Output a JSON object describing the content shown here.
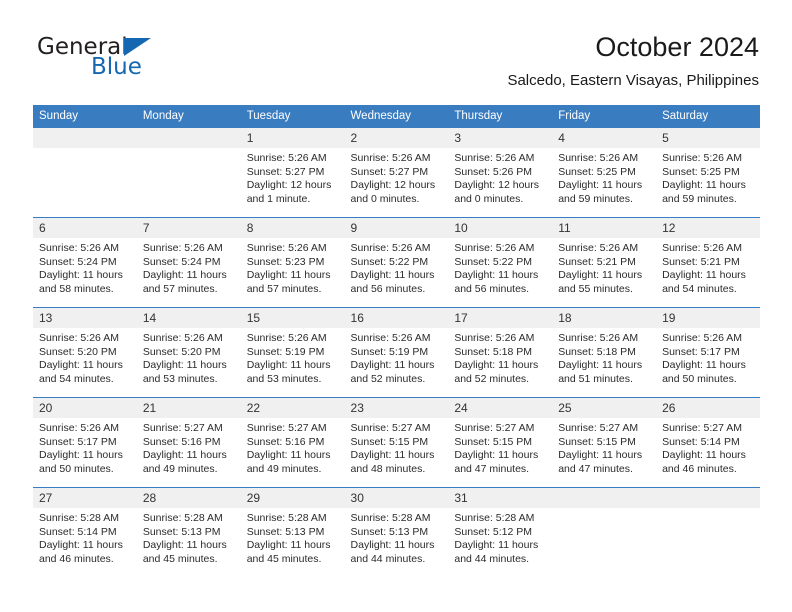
{
  "logo": {
    "word_top": "General",
    "word_bottom": "Blue",
    "triangle_color": "#1567b2",
    "text_color": "#231f20"
  },
  "header": {
    "title": "October 2024",
    "subtitle": "Salcedo, Eastern Visayas, Philippines"
  },
  "theme": {
    "header_blue": "#3a7cc0",
    "daynum_bg": "#f0f0f0",
    "text": "#2b2b2b"
  },
  "weekdays": [
    "Sunday",
    "Monday",
    "Tuesday",
    "Wednesday",
    "Thursday",
    "Friday",
    "Saturday"
  ],
  "labels": {
    "sunrise": "Sunrise:",
    "sunset": "Sunset:",
    "daylight": "Daylight:"
  },
  "weeks": [
    [
      {
        "day": "",
        "sunrise": "",
        "sunset": "",
        "daylight": ""
      },
      {
        "day": "",
        "sunrise": "",
        "sunset": "",
        "daylight": ""
      },
      {
        "day": "1",
        "sunrise": "Sunrise: 5:26 AM",
        "sunset": "Sunset: 5:27 PM",
        "daylight": "Daylight: 12 hours and 1 minute."
      },
      {
        "day": "2",
        "sunrise": "Sunrise: 5:26 AM",
        "sunset": "Sunset: 5:27 PM",
        "daylight": "Daylight: 12 hours and 0 minutes."
      },
      {
        "day": "3",
        "sunrise": "Sunrise: 5:26 AM",
        "sunset": "Sunset: 5:26 PM",
        "daylight": "Daylight: 12 hours and 0 minutes."
      },
      {
        "day": "4",
        "sunrise": "Sunrise: 5:26 AM",
        "sunset": "Sunset: 5:25 PM",
        "daylight": "Daylight: 11 hours and 59 minutes."
      },
      {
        "day": "5",
        "sunrise": "Sunrise: 5:26 AM",
        "sunset": "Sunset: 5:25 PM",
        "daylight": "Daylight: 11 hours and 59 minutes."
      }
    ],
    [
      {
        "day": "6",
        "sunrise": "Sunrise: 5:26 AM",
        "sunset": "Sunset: 5:24 PM",
        "daylight": "Daylight: 11 hours and 58 minutes."
      },
      {
        "day": "7",
        "sunrise": "Sunrise: 5:26 AM",
        "sunset": "Sunset: 5:24 PM",
        "daylight": "Daylight: 11 hours and 57 minutes."
      },
      {
        "day": "8",
        "sunrise": "Sunrise: 5:26 AM",
        "sunset": "Sunset: 5:23 PM",
        "daylight": "Daylight: 11 hours and 57 minutes."
      },
      {
        "day": "9",
        "sunrise": "Sunrise: 5:26 AM",
        "sunset": "Sunset: 5:22 PM",
        "daylight": "Daylight: 11 hours and 56 minutes."
      },
      {
        "day": "10",
        "sunrise": "Sunrise: 5:26 AM",
        "sunset": "Sunset: 5:22 PM",
        "daylight": "Daylight: 11 hours and 56 minutes."
      },
      {
        "day": "11",
        "sunrise": "Sunrise: 5:26 AM",
        "sunset": "Sunset: 5:21 PM",
        "daylight": "Daylight: 11 hours and 55 minutes."
      },
      {
        "day": "12",
        "sunrise": "Sunrise: 5:26 AM",
        "sunset": "Sunset: 5:21 PM",
        "daylight": "Daylight: 11 hours and 54 minutes."
      }
    ],
    [
      {
        "day": "13",
        "sunrise": "Sunrise: 5:26 AM",
        "sunset": "Sunset: 5:20 PM",
        "daylight": "Daylight: 11 hours and 54 minutes."
      },
      {
        "day": "14",
        "sunrise": "Sunrise: 5:26 AM",
        "sunset": "Sunset: 5:20 PM",
        "daylight": "Daylight: 11 hours and 53 minutes."
      },
      {
        "day": "15",
        "sunrise": "Sunrise: 5:26 AM",
        "sunset": "Sunset: 5:19 PM",
        "daylight": "Daylight: 11 hours and 53 minutes."
      },
      {
        "day": "16",
        "sunrise": "Sunrise: 5:26 AM",
        "sunset": "Sunset: 5:19 PM",
        "daylight": "Daylight: 11 hours and 52 minutes."
      },
      {
        "day": "17",
        "sunrise": "Sunrise: 5:26 AM",
        "sunset": "Sunset: 5:18 PM",
        "daylight": "Daylight: 11 hours and 52 minutes."
      },
      {
        "day": "18",
        "sunrise": "Sunrise: 5:26 AM",
        "sunset": "Sunset: 5:18 PM",
        "daylight": "Daylight: 11 hours and 51 minutes."
      },
      {
        "day": "19",
        "sunrise": "Sunrise: 5:26 AM",
        "sunset": "Sunset: 5:17 PM",
        "daylight": "Daylight: 11 hours and 50 minutes."
      }
    ],
    [
      {
        "day": "20",
        "sunrise": "Sunrise: 5:26 AM",
        "sunset": "Sunset: 5:17 PM",
        "daylight": "Daylight: 11 hours and 50 minutes."
      },
      {
        "day": "21",
        "sunrise": "Sunrise: 5:27 AM",
        "sunset": "Sunset: 5:16 PM",
        "daylight": "Daylight: 11 hours and 49 minutes."
      },
      {
        "day": "22",
        "sunrise": "Sunrise: 5:27 AM",
        "sunset": "Sunset: 5:16 PM",
        "daylight": "Daylight: 11 hours and 49 minutes."
      },
      {
        "day": "23",
        "sunrise": "Sunrise: 5:27 AM",
        "sunset": "Sunset: 5:15 PM",
        "daylight": "Daylight: 11 hours and 48 minutes."
      },
      {
        "day": "24",
        "sunrise": "Sunrise: 5:27 AM",
        "sunset": "Sunset: 5:15 PM",
        "daylight": "Daylight: 11 hours and 47 minutes."
      },
      {
        "day": "25",
        "sunrise": "Sunrise: 5:27 AM",
        "sunset": "Sunset: 5:15 PM",
        "daylight": "Daylight: 11 hours and 47 minutes."
      },
      {
        "day": "26",
        "sunrise": "Sunrise: 5:27 AM",
        "sunset": "Sunset: 5:14 PM",
        "daylight": "Daylight: 11 hours and 46 minutes."
      }
    ],
    [
      {
        "day": "27",
        "sunrise": "Sunrise: 5:28 AM",
        "sunset": "Sunset: 5:14 PM",
        "daylight": "Daylight: 11 hours and 46 minutes."
      },
      {
        "day": "28",
        "sunrise": "Sunrise: 5:28 AM",
        "sunset": "Sunset: 5:13 PM",
        "daylight": "Daylight: 11 hours and 45 minutes."
      },
      {
        "day": "29",
        "sunrise": "Sunrise: 5:28 AM",
        "sunset": "Sunset: 5:13 PM",
        "daylight": "Daylight: 11 hours and 45 minutes."
      },
      {
        "day": "30",
        "sunrise": "Sunrise: 5:28 AM",
        "sunset": "Sunset: 5:13 PM",
        "daylight": "Daylight: 11 hours and 44 minutes."
      },
      {
        "day": "31",
        "sunrise": "Sunrise: 5:28 AM",
        "sunset": "Sunset: 5:12 PM",
        "daylight": "Daylight: 11 hours and 44 minutes."
      },
      {
        "day": "",
        "sunrise": "",
        "sunset": "",
        "daylight": ""
      },
      {
        "day": "",
        "sunrise": "",
        "sunset": "",
        "daylight": ""
      }
    ]
  ]
}
